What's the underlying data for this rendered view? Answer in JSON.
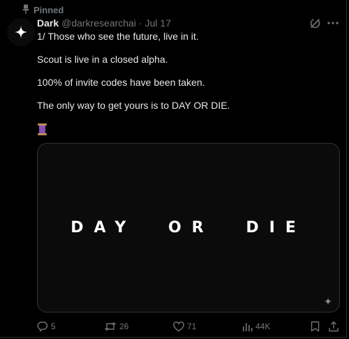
{
  "pinned": {
    "label": "Pinned"
  },
  "tweet": {
    "display_name": "Dark",
    "handle": "@darkresearchai",
    "separator": "·",
    "date": "Jul 17",
    "paragraphs": [
      "1/ Those who see the future, live in it.",
      "Scout is live in a closed alpha.",
      "100% of invite codes have been taken.",
      "The only way to get yours is to DAY OR DIE."
    ],
    "emoji_icon": "thread-spool-icon",
    "media": {
      "words": [
        "DAY",
        "OR",
        "DIE"
      ]
    },
    "actions": {
      "replies": "5",
      "reposts": "26",
      "likes": "71",
      "views": "44K"
    }
  },
  "colors": {
    "background": "#000000",
    "text": "#e7e9ea",
    "muted": "#71767b",
    "border": "#2f3336",
    "spool": "#8e5bb5"
  }
}
